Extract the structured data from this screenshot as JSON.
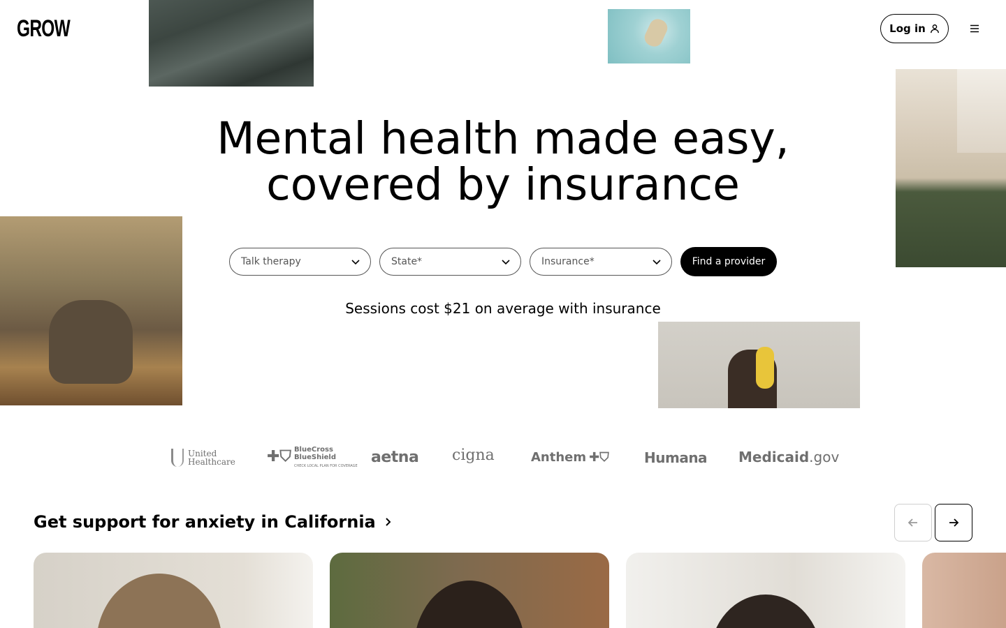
{
  "header": {
    "logo": "GROW",
    "login_label": "Log in"
  },
  "hero": {
    "title_line1": "Mental health made easy,",
    "title_line2": "covered by insurance"
  },
  "search": {
    "service_value": "Talk therapy",
    "state_placeholder": "State*",
    "insurance_placeholder": "Insurance*",
    "submit_label": "Find a provider"
  },
  "sessions_note": "Sessions cost $21 on average with insurance",
  "insurers": {
    "uhc_line1": "United",
    "uhc_line2": "Healthcare",
    "bcbs_line1": "BlueCross",
    "bcbs_line2": "BlueShield",
    "bcbs_sub": "CHECK LOCAL PLAN FOR COVERAGE",
    "aetna": "aetna",
    "cigna": "cigna",
    "anthem": "Anthem",
    "humana": "Humana",
    "medicaid_main": "Medicaid",
    "medicaid_suffix": ".gov"
  },
  "providers_section": {
    "title": "Get support for anxiety in California"
  }
}
